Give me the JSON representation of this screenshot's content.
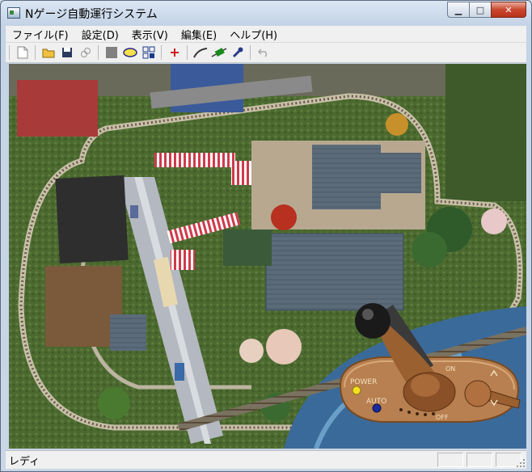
{
  "window": {
    "title": "Nゲージ自動運行システム"
  },
  "menu": [
    "ファイル(F)",
    "設定(D)",
    "表示(V)",
    "編集(E)",
    "ヘルプ(H)"
  ],
  "toolbar": {
    "icons": [
      "new-document-icon",
      "open-folder-icon",
      "save-disk-icon",
      "link-icon",
      "stop-square-icon",
      "oval-track-icon",
      "grid-layout-icon",
      "plus-icon",
      "rail-curve-icon",
      "locomotive-icon",
      "wrench-icon",
      "undo-icon"
    ]
  },
  "controller": {
    "label_power": "POWER",
    "label_auto": "AUTO",
    "label_off": "OFF",
    "label_on": "ON"
  },
  "status": {
    "text": "レディ"
  }
}
